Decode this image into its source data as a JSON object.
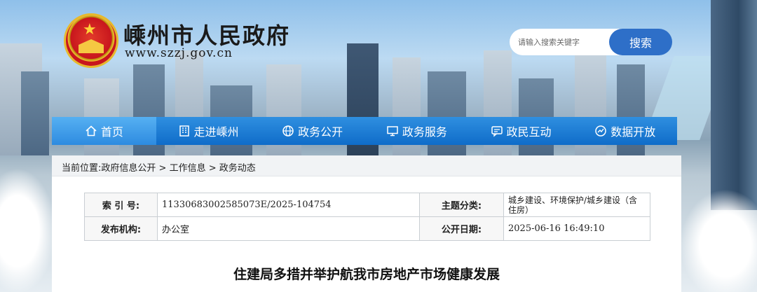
{
  "header": {
    "site_title": "嵊州市人民政府",
    "site_url": "www.szzj.gov.cn",
    "search_placeholder": "请输入搜索关键字",
    "search_button": "搜索"
  },
  "nav": {
    "items": [
      {
        "label": "首页",
        "icon": "home-icon"
      },
      {
        "label": "走进嵊州",
        "icon": "building-icon"
      },
      {
        "label": "政务公开",
        "icon": "globe-icon"
      },
      {
        "label": "政务服务",
        "icon": "monitor-icon"
      },
      {
        "label": "政民互动",
        "icon": "chat-icon"
      },
      {
        "label": "数据开放",
        "icon": "database-icon"
      }
    ]
  },
  "breadcrumb": {
    "prefix": "当前位置:",
    "items": [
      "政府信息公开",
      ">",
      "工作信息",
      ">",
      "政务动态"
    ]
  },
  "meta": {
    "index_label": "索 引 号:",
    "index_value": "11330683002585073E/2025-104754",
    "topic_label": "主题分类:",
    "topic_value": "城乡建设、环境保护/城乡建设（含住房）",
    "publisher_label": "发布机构:",
    "publisher_value": "办公室",
    "date_label": "公开日期:",
    "date_value": "2025-06-16 16:49:10"
  },
  "article": {
    "title": "住建局多措并举护航我市房地产市场健康发展"
  },
  "colors": {
    "nav_bg": "#0f6cc9",
    "nav_active": "#2d8be0",
    "search_btn": "#2e6fc8"
  }
}
